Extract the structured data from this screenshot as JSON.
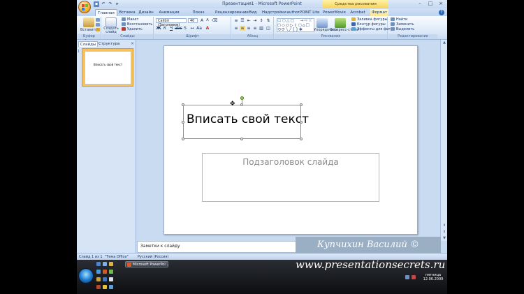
{
  "window": {
    "title": "Презентация1 - Microsoft PowerPoint",
    "context_group": "Средства рисования"
  },
  "quick_access": [
    "save-icon",
    "undo-icon",
    "redo-icon",
    "slideshow-icon"
  ],
  "tabs": [
    {
      "label": "Главная",
      "active": true
    },
    {
      "label": "Вставка"
    },
    {
      "label": "Дизайн"
    },
    {
      "label": "Анимация"
    },
    {
      "label": "Показ слайдов"
    },
    {
      "label": "Рецензирование"
    },
    {
      "label": "Вид"
    },
    {
      "label": "Надстройки"
    },
    {
      "label": "authorPOINT Lite"
    },
    {
      "label": "PowerMovie"
    },
    {
      "label": "Acrobat"
    },
    {
      "label": "Формат",
      "context": true
    }
  ],
  "ribbon": {
    "clipboard": {
      "paste": "Вставить",
      "label": "Буфер обмена"
    },
    "slides": {
      "new_slide": "Создать слайд",
      "layout": "Макет",
      "reset": "Восстановить",
      "delete": "Удалить",
      "label": "Слайды"
    },
    "font": {
      "name": "Calibri (Заголовки)",
      "size": "40",
      "bold": "Ж",
      "italic": "К",
      "underline": "Ч",
      "label": "Шрифт"
    },
    "paragraph": {
      "label": "Абзац"
    },
    "drawing": {
      "arrange": "Упорядочить",
      "quick_styles": "Экспресс-стили",
      "fill": "Заливка фигуры",
      "outline": "Контур фигуры",
      "effects": "Эффекты для фигур",
      "label": "Рисование"
    },
    "editing": {
      "find": "Найти",
      "replace": "Заменить",
      "select": "Выделить",
      "label": "Редактирование"
    }
  },
  "pane": {
    "tab_slides": "Слайды",
    "tab_outline": "Структура",
    "slide_number": "1",
    "thumb_text": "Вписать свой текст"
  },
  "slide": {
    "title": "Вписать свой текст",
    "subtitle": "Подзаголовок слайда"
  },
  "notes": {
    "placeholder": "Заметки к слайду"
  },
  "status": {
    "slide": "Слайд 1 из 1",
    "theme": "\"Тема Office\"",
    "language": "Русский (Россия)"
  },
  "taskbar": {
    "task_label": "Microsoft PowerPoi...",
    "day": "пятница",
    "date": "12.06.2009"
  },
  "watermark": {
    "author": "Купчихин Василий ©",
    "url": "www.presentationsecrets.ru"
  },
  "colors": {
    "accent": "#c9dbf1",
    "selected_thumb": "#f7c15c"
  }
}
